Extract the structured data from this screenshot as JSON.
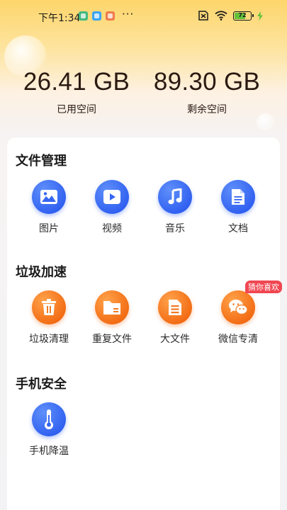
{
  "status_bar": {
    "time": "下午1:34",
    "more": "···",
    "battery": "72",
    "battery_level": 0.72
  },
  "storage": {
    "used_value": "26.41 GB",
    "used_label": "已用空间",
    "free_value": "89.30 GB",
    "free_label": "剩余空间"
  },
  "sections": {
    "file_manage": {
      "title": "文件管理",
      "items": [
        {
          "label": "图片",
          "icon": "image-icon"
        },
        {
          "label": "视频",
          "icon": "video-icon"
        },
        {
          "label": "音乐",
          "icon": "music-icon"
        },
        {
          "label": "文档",
          "icon": "document-icon"
        }
      ]
    },
    "junk": {
      "title": "垃圾加速",
      "items": [
        {
          "label": "垃圾清理",
          "icon": "trash-icon"
        },
        {
          "label": "重复文件",
          "icon": "folder-icon"
        },
        {
          "label": "大文件",
          "icon": "large-file-icon"
        },
        {
          "label": "微信专清",
          "icon": "wechat-icon",
          "badge": "猜你喜欢"
        }
      ]
    },
    "security": {
      "title": "手机安全",
      "items": [
        {
          "label": "手机降温",
          "icon": "thermometer-icon"
        }
      ]
    }
  },
  "colors": {
    "accent_blue": "#2f5ff0",
    "accent_orange": "#f26a12",
    "badge_red": "#f04752",
    "header_yellow": "#fdd56b"
  }
}
